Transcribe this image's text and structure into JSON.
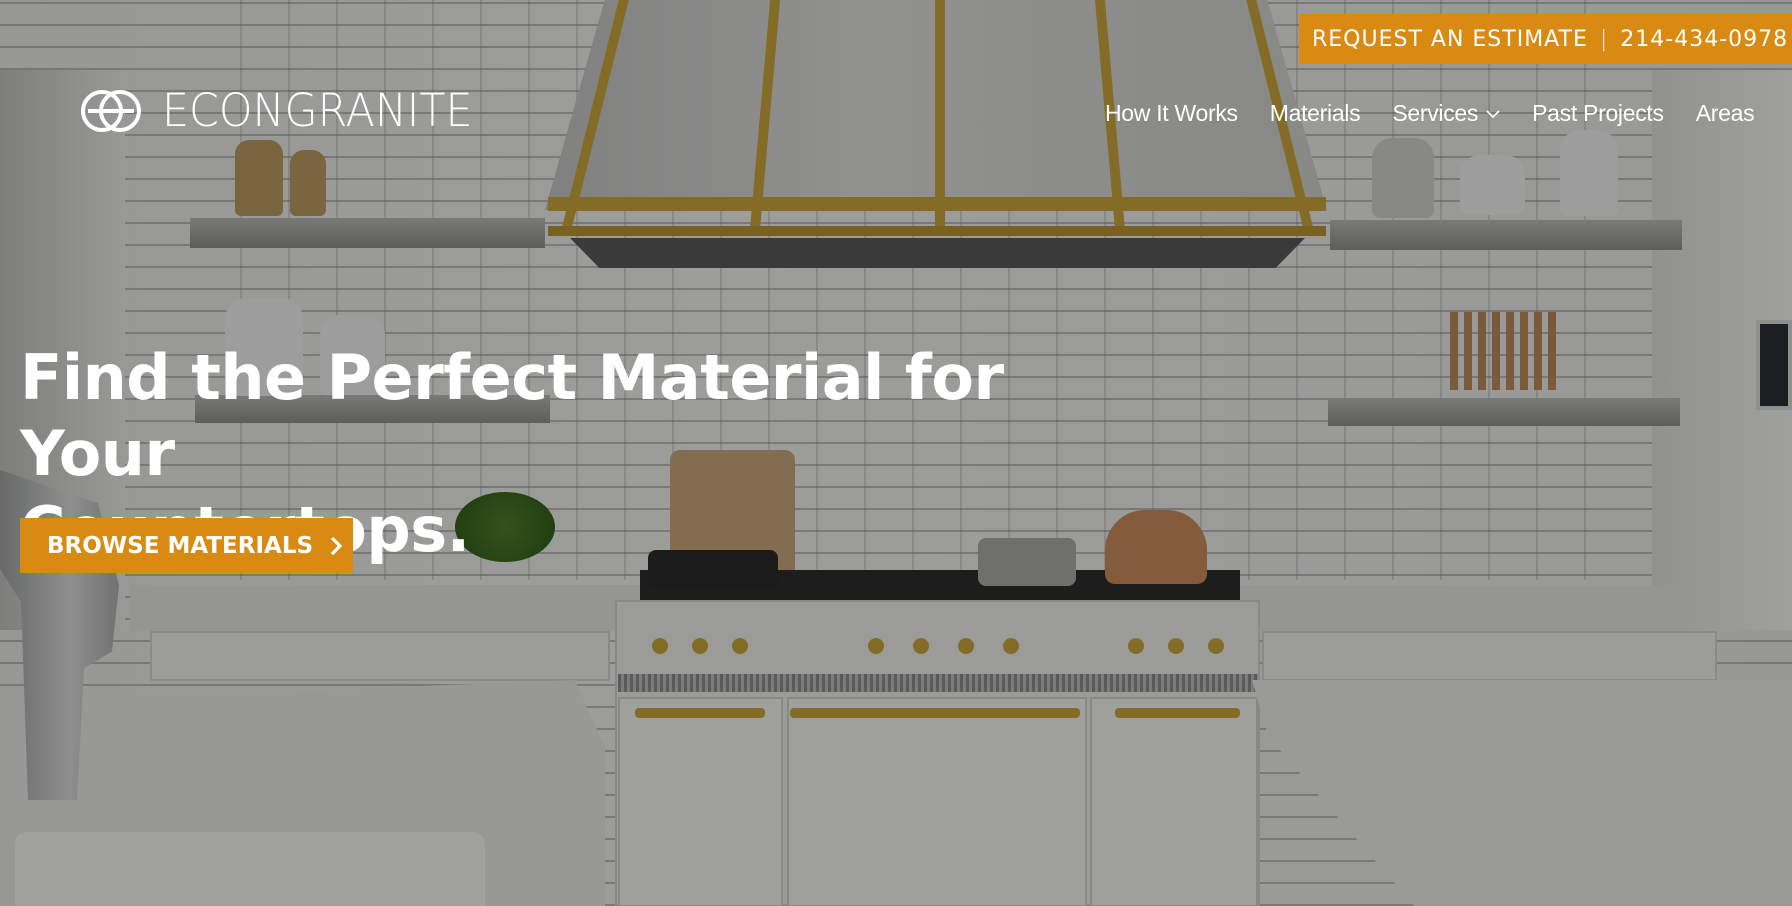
{
  "brand": {
    "name": "ECONGRANITE",
    "accent": "#d98a12"
  },
  "topbar": {
    "estimate_label": "REQUEST AN ESTIMATE",
    "separator": "|",
    "phone": "214-434-0978"
  },
  "nav": {
    "items": [
      {
        "label": "How It Works"
      },
      {
        "label": "Materials"
      },
      {
        "label": "Services",
        "icon": "chevron-down-icon"
      },
      {
        "label": "Past Projects"
      },
      {
        "label": "Areas"
      }
    ]
  },
  "hero": {
    "headline_line1": "Find the Perfect Material for Your",
    "headline_line2": "Countertops.",
    "cta_label": "BROWSE MATERIALS",
    "cta_icon": "chevron-right-icon"
  }
}
